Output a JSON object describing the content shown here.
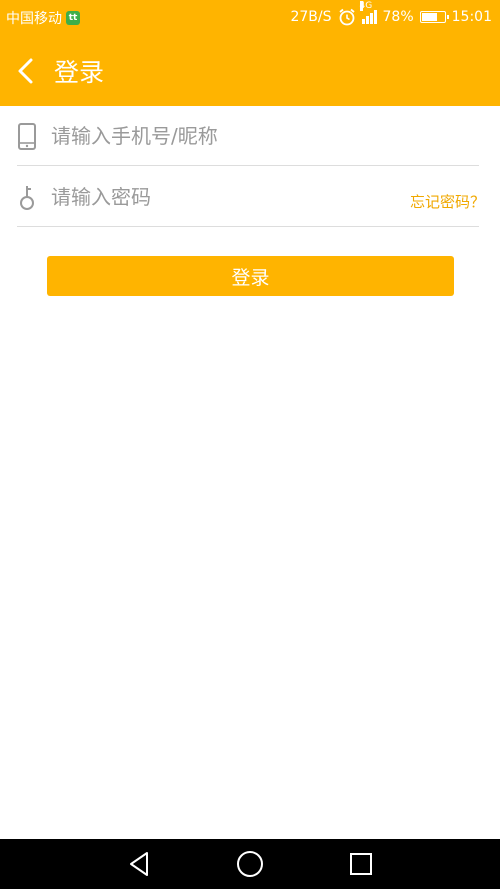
{
  "status_bar": {
    "carrier": "中国移动",
    "carrier_badge": "tt",
    "speed": "27B/S",
    "network": "4G",
    "battery_percent": "78%",
    "battery_level": 0.78,
    "time": "15:01"
  },
  "app_bar": {
    "title": "登录",
    "back_icon": "chevron-left-icon"
  },
  "form": {
    "account_placeholder": "请输入手机号/昵称",
    "account_value": "",
    "account_icon": "phone-icon",
    "password_placeholder": "请输入密码",
    "password_value": "",
    "password_icon": "key-icon",
    "forgot_label": "忘记密码？",
    "submit_label": "登录"
  },
  "nav_bar": {
    "back_icon": "triangle-back-icon",
    "home_icon": "circle-home-icon",
    "recents_icon": "square-recents-icon"
  },
  "colors": {
    "accent": "#FFB400",
    "link": "#F0A800",
    "nav_background": "#000000"
  }
}
